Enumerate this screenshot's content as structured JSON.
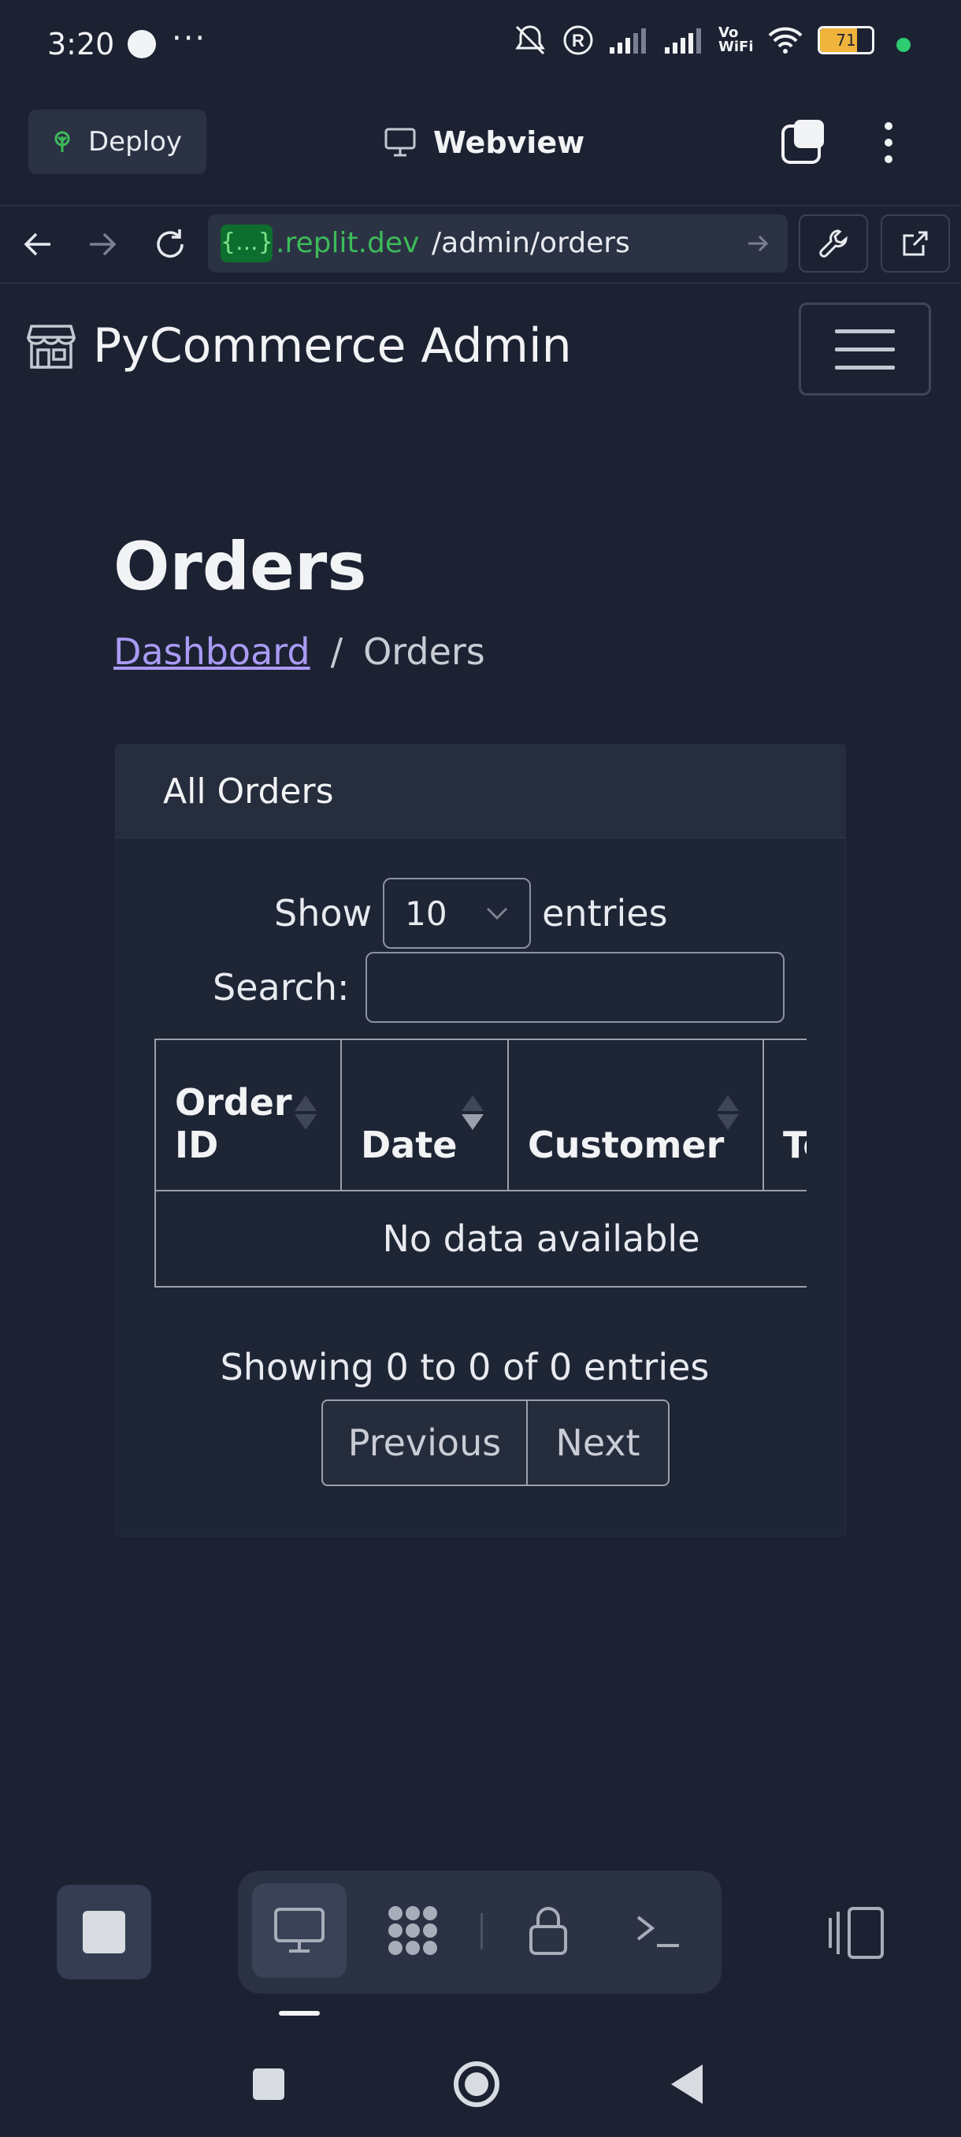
{
  "status_bar": {
    "time": "3:20",
    "overflow": "···",
    "battery_level": "71",
    "battery_fraction": 0.71,
    "icons": [
      "messenger-icon",
      "mute-icon",
      "registered-icon",
      "signal-icon",
      "signal-icon",
      "vowifi-icon",
      "wifi-icon",
      "battery-icon"
    ],
    "vowifi": "Vo WiFi"
  },
  "replit": {
    "deploy_label": "Deploy",
    "webview_title": "Webview",
    "url_prefix": "{...}",
    "url_domain": ".replit.dev",
    "url_path": "/admin/orders"
  },
  "app": {
    "brand": "PyCommerce Admin",
    "page_title": "Orders",
    "breadcrumb": {
      "home": "Dashboard",
      "separator": "/",
      "current": "Orders"
    },
    "card_title": "All Orders",
    "length": {
      "show": "Show",
      "value": "10",
      "entries": "entries"
    },
    "search_label": "Search:",
    "columns": [
      "Order ID",
      "Date",
      "Customer",
      "To"
    ],
    "empty_message": "No data available",
    "info": "Showing 0 to 0 of 0 entries",
    "pager": {
      "previous": "Previous",
      "next": "Next"
    }
  },
  "colors": {
    "background": "#1c2232",
    "link": "#a99bf5",
    "url_domain": "#3dbb5a",
    "status_dot": "#2ecc71"
  }
}
